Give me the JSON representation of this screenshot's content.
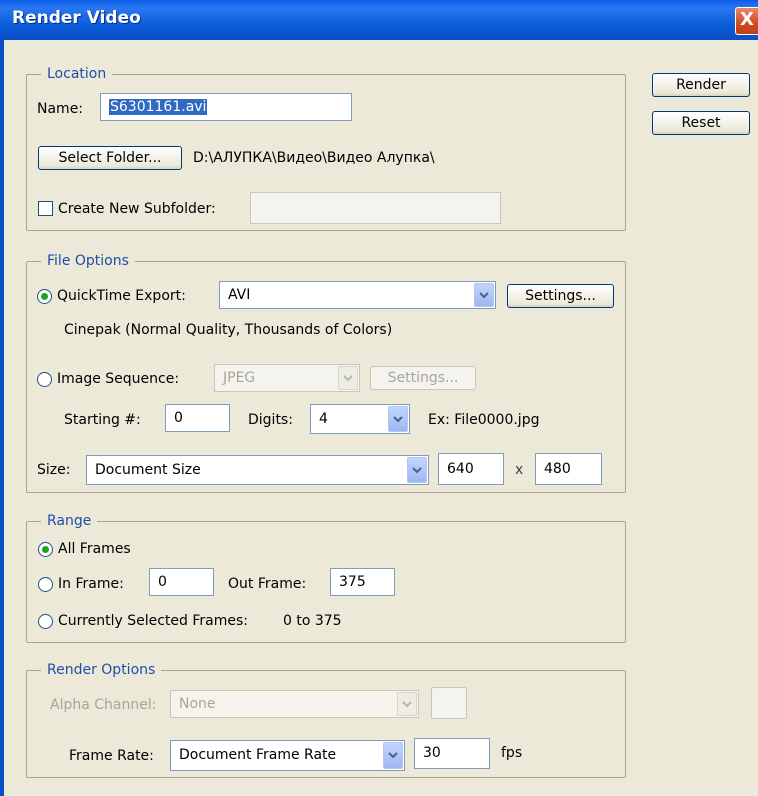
{
  "window": {
    "title": "Render Video",
    "close_glyph": "X"
  },
  "side_buttons": {
    "render": "Render",
    "reset": "Reset"
  },
  "location": {
    "legend": "Location",
    "name_label": "Name:",
    "name_value": "S6301161.avi",
    "select_folder_label": "Select Folder...",
    "folder_path": "D:\\АЛУПКА\\Видео\\Видео Алупка\\",
    "create_subfolder_label": "Create New Subfolder:",
    "create_subfolder_checked": false,
    "subfolder_value": ""
  },
  "file_options": {
    "legend": "File Options",
    "quicktime_label": "QuickTime Export:",
    "quicktime_checked": true,
    "quicktime_format": "AVI",
    "settings_label": "Settings...",
    "codec_description": "Cinepak (Normal Quality, Thousands of Colors)",
    "image_sequence_label": "Image Sequence:",
    "image_sequence_checked": false,
    "image_format": "JPEG",
    "image_settings_label": "Settings...",
    "starting_label": "Starting #:",
    "starting_value": "0",
    "digits_label": "Digits:",
    "digits_value": "4",
    "example_text": "Ex: File0000.jpg",
    "size_label": "Size:",
    "size_value": "Document Size",
    "width": "640",
    "by": "x",
    "height": "480"
  },
  "range": {
    "legend": "Range",
    "all_frames_label": "All Frames",
    "all_frames_checked": true,
    "in_frame_label": "In Frame:",
    "in_frame_value": "0",
    "out_frame_label": "Out Frame:",
    "out_frame_value": "375",
    "current_label": "Currently Selected Frames:",
    "current_value": "0 to 375"
  },
  "render_options": {
    "legend": "Render Options",
    "alpha_label": "Alpha Channel:",
    "alpha_value": "None",
    "frame_rate_label": "Frame Rate:",
    "frame_rate_value": "Document Frame Rate",
    "fps_value": "30",
    "fps_unit": "fps"
  },
  "icons": [
    "close-icon",
    "chevron-down-icon",
    "radio-icon",
    "checkbox-icon"
  ],
  "colors": {
    "titlebar": "#0a5fe8",
    "legend_text": "#1f4ea8",
    "dialog_bg": "#ece9d8",
    "selection": "#316ac5",
    "radio_dot": "#21a121"
  }
}
